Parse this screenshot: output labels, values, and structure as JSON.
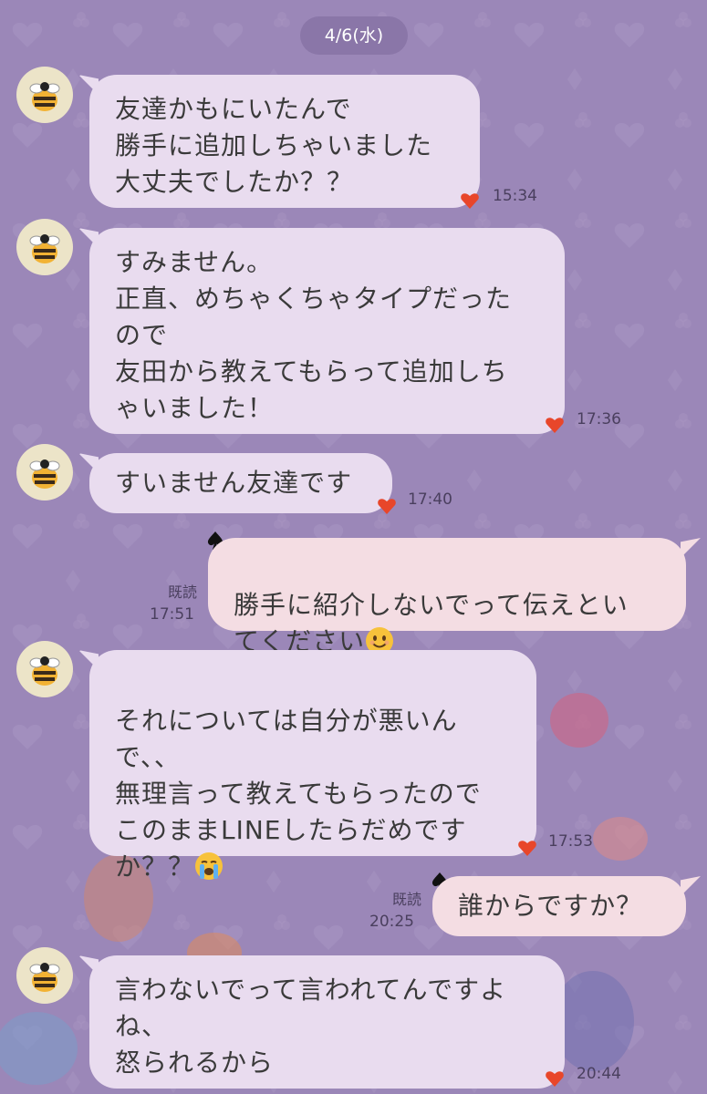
{
  "date_chip": "4/6(水)",
  "messages": [
    {
      "text": "友達かもにいたんで\n勝手に追加しちゃいました\n大丈夫でしたか？？",
      "time": "15:34"
    },
    {
      "text": "すみません。\n正直、めちゃくちゃタイプだった\nので\n友田から教えてもらって追加しち\nゃいました！",
      "time": "17:36"
    },
    {
      "text": "すいません友達です",
      "time": "17:40"
    },
    {
      "text": "勝手に紹介しないでって伝えとい\nてください",
      "time": "17:51",
      "read": "既読"
    },
    {
      "text": "それについては自分が悪いん\nで、、\n無理言って教えてもらったので\nこのままLINEしたらだめです\nか？？",
      "time": "17:53"
    },
    {
      "text": "誰からですか？",
      "time": "20:25",
      "read": "既読"
    },
    {
      "text": "言わないでって言われてんですよ\nね、\n怒られるから",
      "time": "20:44"
    }
  ],
  "colors": {
    "background": "#9b87b8",
    "incoming_bubble": "#e9dcef",
    "outgoing_bubble": "#f4dde3",
    "heart": "#e8462a"
  },
  "icons": {
    "avatar": "bee-icon",
    "reaction": "heart-icon",
    "reaction_out": "spade-icon",
    "emoji_smile": "smiling-face-emoji",
    "emoji_cry": "crying-face-emoji"
  }
}
